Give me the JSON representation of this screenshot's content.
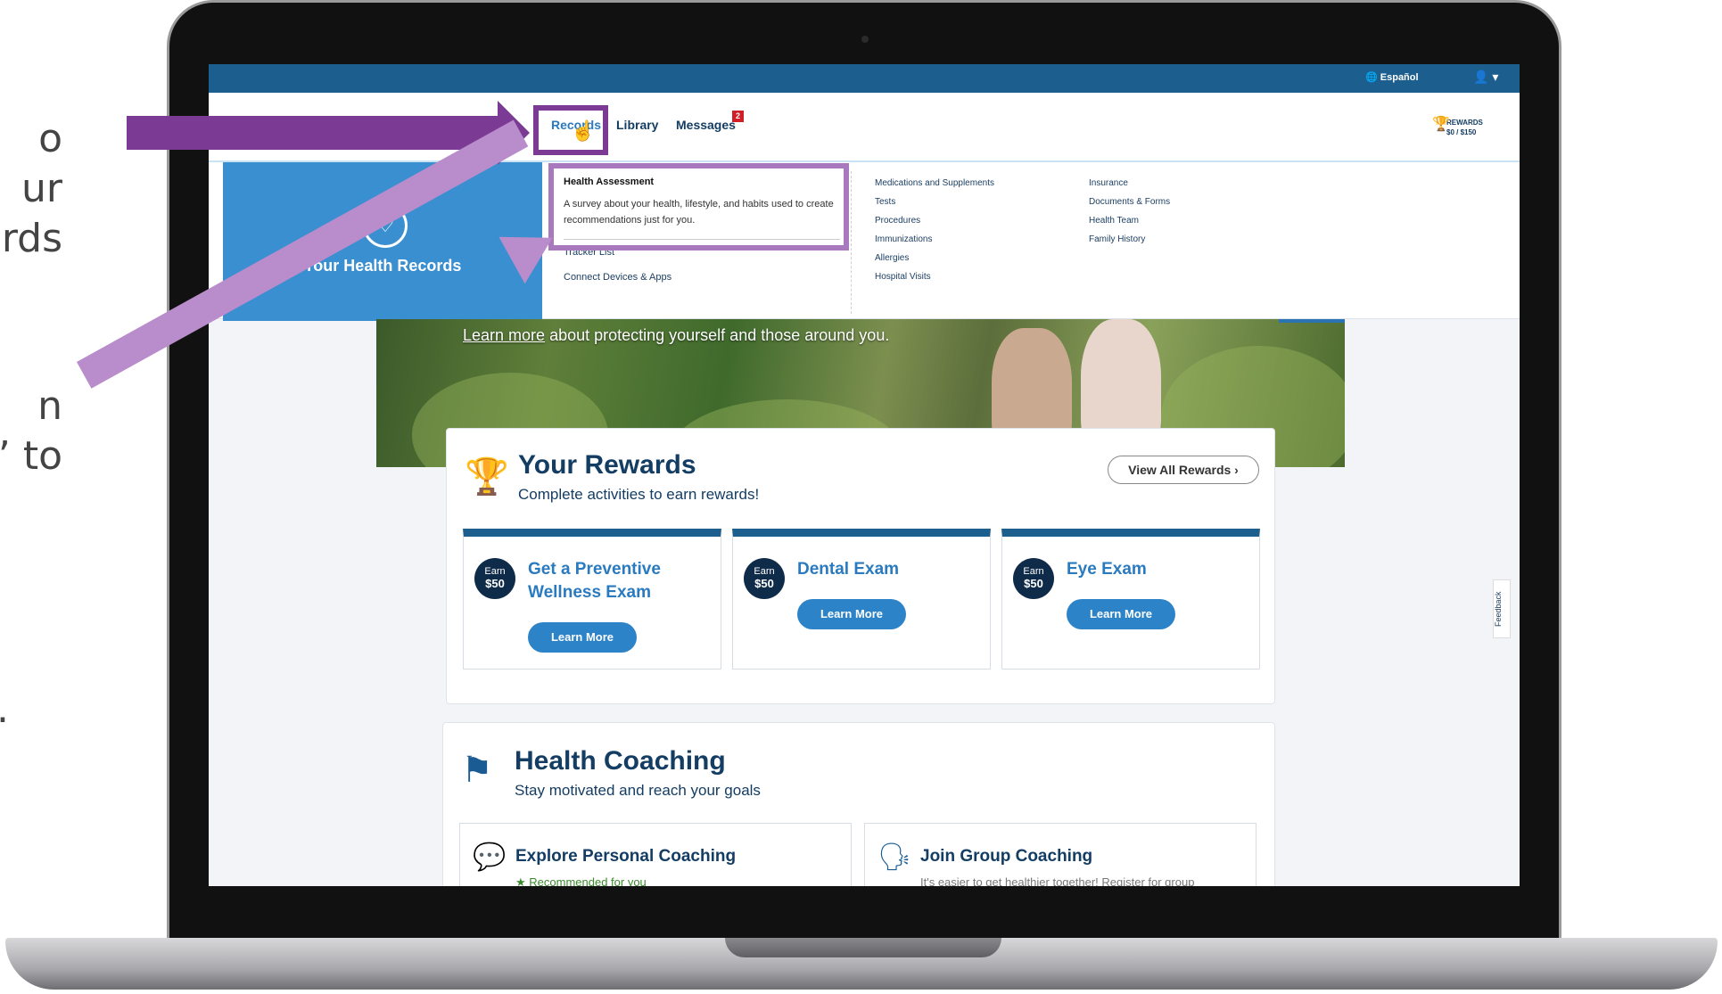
{
  "tutorial_text": {
    "line_a": "o\nur\nrds",
    "line_b": "n\n” to",
    "line_c": "."
  },
  "topbar": {
    "language": "Español",
    "account_icon": "user-icon"
  },
  "nav": {
    "records": "Records",
    "library": "Library",
    "messages": "Messages",
    "messages_badge": "2",
    "rewards_label": "REWARDS",
    "rewards_value": "$0 / $150"
  },
  "dropdown": {
    "panel_title": "Your Health Records",
    "health_assessment": {
      "title": "Health Assessment",
      "description": "A survey about your health, lifestyle, and habits used to create recommendations just for you."
    },
    "left_items": [
      "Tracker List",
      "Connect Devices & Apps"
    ],
    "mid_items": [
      "Medications and Supplements",
      "Tests",
      "Procedures",
      "Immunizations",
      "Allergies",
      "Hospital Visits"
    ],
    "right_items": [
      "Insurance",
      "Documents & Forms",
      "Health Team",
      "Family History"
    ]
  },
  "hero": {
    "link": "Learn more",
    "text": " about protecting yourself and those around you."
  },
  "rewards": {
    "title": "Your Rewards",
    "subtitle": "Complete activities to earn rewards!",
    "view_all": "View All Rewards",
    "tiles": [
      {
        "earn": "Earn",
        "amount": "$50",
        "title": "Get a Preventive Wellness Exam",
        "button": "Learn More"
      },
      {
        "earn": "Earn",
        "amount": "$50",
        "title": "Dental Exam",
        "button": "Learn More"
      },
      {
        "earn": "Earn",
        "amount": "$50",
        "title": "Eye Exam",
        "button": "Learn More"
      }
    ]
  },
  "coaching": {
    "title": "Health Coaching",
    "subtitle": "Stay motivated and reach your goals",
    "tiles": [
      {
        "title": "Explore Personal Coaching",
        "sub": "Recommended for you"
      },
      {
        "title": "Join Group Coaching",
        "sub": "It's easier to get healthier together! Register for group"
      }
    ]
  },
  "feedback": "Feedback",
  "colors": {
    "highlight": "#7b3a93",
    "highlight_light": "#b98ccb",
    "brand_blue": "#1c5f8f",
    "button_blue": "#2d83c8"
  }
}
